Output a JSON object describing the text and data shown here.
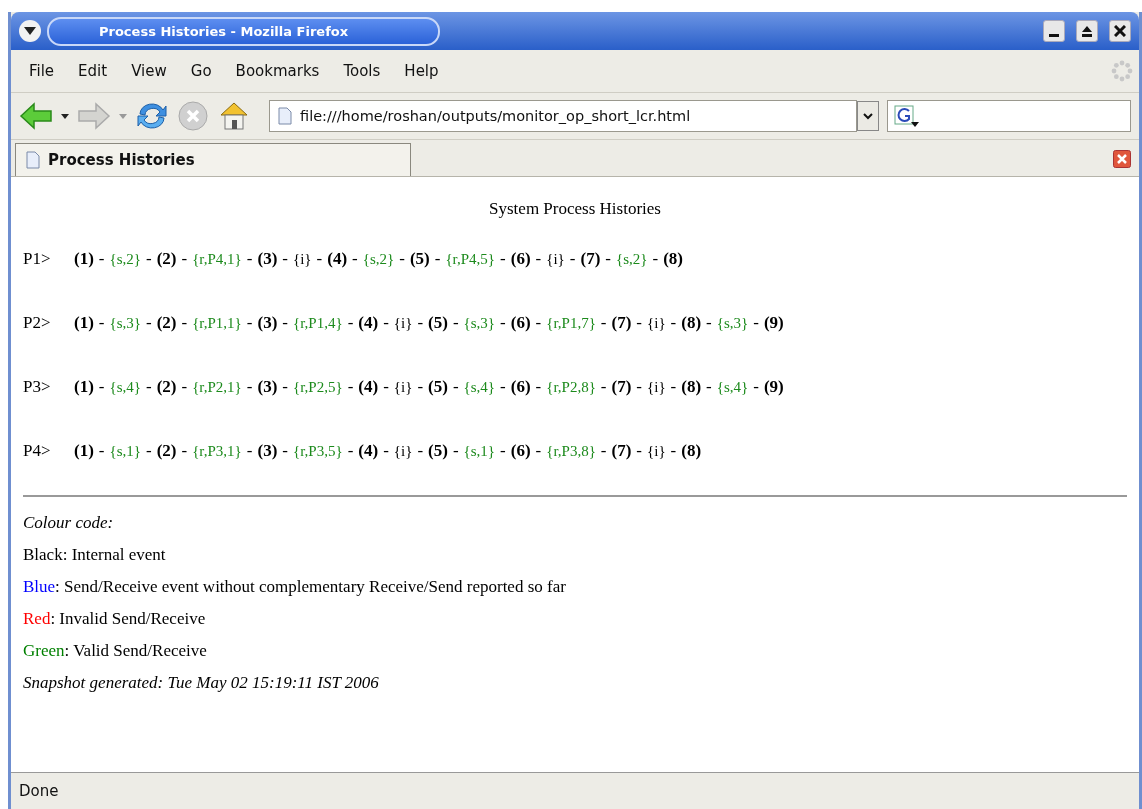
{
  "window": {
    "title": "Process Histories - Mozilla Firefox"
  },
  "menu": [
    "File",
    "Edit",
    "View",
    "Go",
    "Bookmarks",
    "Tools",
    "Help"
  ],
  "toolbar": {
    "back_disabled": false,
    "forward_disabled": true,
    "stop_disabled": true,
    "url": "file:///home/roshan/outputs/monitor_op_short_lcr.html"
  },
  "tabs": [
    {
      "label": "Process Histories",
      "selected": true
    }
  ],
  "page": {
    "heading": "System Process Histories",
    "processes": [
      {
        "label": "P1>",
        "items": [
          {
            "text": "(1)",
            "kind": "state"
          },
          {
            "text": "-",
            "kind": "dash"
          },
          {
            "text": "{s,2}",
            "kind": "valid"
          },
          {
            "text": "-",
            "kind": "dash"
          },
          {
            "text": "(2)",
            "kind": "state"
          },
          {
            "text": "-",
            "kind": "dash"
          },
          {
            "text": "{r,P4,1}",
            "kind": "valid"
          },
          {
            "text": "-",
            "kind": "dash"
          },
          {
            "text": "(3)",
            "kind": "state"
          },
          {
            "text": "-",
            "kind": "dash"
          },
          {
            "text": "{i}",
            "kind": "internal"
          },
          {
            "text": "-",
            "kind": "dash"
          },
          {
            "text": "(4)",
            "kind": "state"
          },
          {
            "text": "-",
            "kind": "dash"
          },
          {
            "text": "{s,2}",
            "kind": "valid"
          },
          {
            "text": "-",
            "kind": "dash"
          },
          {
            "text": "(5)",
            "kind": "state"
          },
          {
            "text": "-",
            "kind": "dash"
          },
          {
            "text": "{r,P4,5}",
            "kind": "valid"
          },
          {
            "text": "-",
            "kind": "dash"
          },
          {
            "text": "(6)",
            "kind": "state"
          },
          {
            "text": "-",
            "kind": "dash"
          },
          {
            "text": "{i}",
            "kind": "internal"
          },
          {
            "text": "-",
            "kind": "dash"
          },
          {
            "text": "(7)",
            "kind": "state"
          },
          {
            "text": "-",
            "kind": "dash"
          },
          {
            "text": "{s,2}",
            "kind": "valid"
          },
          {
            "text": "-",
            "kind": "dash"
          },
          {
            "text": "(8)",
            "kind": "state"
          }
        ]
      },
      {
        "label": "P2>",
        "items": [
          {
            "text": "(1)",
            "kind": "state"
          },
          {
            "text": "-",
            "kind": "dash"
          },
          {
            "text": "{s,3}",
            "kind": "valid"
          },
          {
            "text": "-",
            "kind": "dash"
          },
          {
            "text": "(2)",
            "kind": "state"
          },
          {
            "text": "-",
            "kind": "dash"
          },
          {
            "text": "{r,P1,1}",
            "kind": "valid"
          },
          {
            "text": "-",
            "kind": "dash"
          },
          {
            "text": "(3)",
            "kind": "state"
          },
          {
            "text": "-",
            "kind": "dash"
          },
          {
            "text": "{r,P1,4}",
            "kind": "valid"
          },
          {
            "text": "-",
            "kind": "dash"
          },
          {
            "text": "(4)",
            "kind": "state"
          },
          {
            "text": "-",
            "kind": "dash"
          },
          {
            "text": "{i}",
            "kind": "internal"
          },
          {
            "text": "-",
            "kind": "dash"
          },
          {
            "text": "(5)",
            "kind": "state"
          },
          {
            "text": "-",
            "kind": "dash"
          },
          {
            "text": "{s,3}",
            "kind": "valid"
          },
          {
            "text": "-",
            "kind": "dash"
          },
          {
            "text": "(6)",
            "kind": "state"
          },
          {
            "text": "-",
            "kind": "dash"
          },
          {
            "text": "{r,P1,7}",
            "kind": "valid"
          },
          {
            "text": "-",
            "kind": "dash"
          },
          {
            "text": "(7)",
            "kind": "state"
          },
          {
            "text": "-",
            "kind": "dash"
          },
          {
            "text": "{i}",
            "kind": "internal"
          },
          {
            "text": "-",
            "kind": "dash"
          },
          {
            "text": "(8)",
            "kind": "state"
          },
          {
            "text": "-",
            "kind": "dash"
          },
          {
            "text": "{s,3}",
            "kind": "valid"
          },
          {
            "text": "-",
            "kind": "dash"
          },
          {
            "text": "(9)",
            "kind": "state"
          }
        ]
      },
      {
        "label": "P3>",
        "items": [
          {
            "text": "(1)",
            "kind": "state"
          },
          {
            "text": "-",
            "kind": "dash"
          },
          {
            "text": "{s,4}",
            "kind": "valid"
          },
          {
            "text": "-",
            "kind": "dash"
          },
          {
            "text": "(2)",
            "kind": "state"
          },
          {
            "text": "-",
            "kind": "dash"
          },
          {
            "text": "{r,P2,1}",
            "kind": "valid"
          },
          {
            "text": "-",
            "kind": "dash"
          },
          {
            "text": "(3)",
            "kind": "state"
          },
          {
            "text": "-",
            "kind": "dash"
          },
          {
            "text": "{r,P2,5}",
            "kind": "valid"
          },
          {
            "text": "-",
            "kind": "dash"
          },
          {
            "text": "(4)",
            "kind": "state"
          },
          {
            "text": "-",
            "kind": "dash"
          },
          {
            "text": "{i}",
            "kind": "internal"
          },
          {
            "text": "-",
            "kind": "dash"
          },
          {
            "text": "(5)",
            "kind": "state"
          },
          {
            "text": "-",
            "kind": "dash"
          },
          {
            "text": "{s,4}",
            "kind": "valid"
          },
          {
            "text": "-",
            "kind": "dash"
          },
          {
            "text": "(6)",
            "kind": "state"
          },
          {
            "text": "-",
            "kind": "dash"
          },
          {
            "text": "{r,P2,8}",
            "kind": "valid"
          },
          {
            "text": "-",
            "kind": "dash"
          },
          {
            "text": "(7)",
            "kind": "state"
          },
          {
            "text": "-",
            "kind": "dash"
          },
          {
            "text": "{i}",
            "kind": "internal"
          },
          {
            "text": "-",
            "kind": "dash"
          },
          {
            "text": "(8)",
            "kind": "state"
          },
          {
            "text": "-",
            "kind": "dash"
          },
          {
            "text": "{s,4}",
            "kind": "valid"
          },
          {
            "text": "-",
            "kind": "dash"
          },
          {
            "text": "(9)",
            "kind": "state"
          }
        ]
      },
      {
        "label": "P4>",
        "items": [
          {
            "text": "(1)",
            "kind": "state"
          },
          {
            "text": "-",
            "kind": "dash"
          },
          {
            "text": "{s,1}",
            "kind": "valid"
          },
          {
            "text": "-",
            "kind": "dash"
          },
          {
            "text": "(2)",
            "kind": "state"
          },
          {
            "text": "-",
            "kind": "dash"
          },
          {
            "text": "{r,P3,1}",
            "kind": "valid"
          },
          {
            "text": "-",
            "kind": "dash"
          },
          {
            "text": "(3)",
            "kind": "state"
          },
          {
            "text": "-",
            "kind": "dash"
          },
          {
            "text": "{r,P3,5}",
            "kind": "valid"
          },
          {
            "text": "-",
            "kind": "dash"
          },
          {
            "text": "(4)",
            "kind": "state"
          },
          {
            "text": "-",
            "kind": "dash"
          },
          {
            "text": "{i}",
            "kind": "internal"
          },
          {
            "text": "-",
            "kind": "dash"
          },
          {
            "text": "(5)",
            "kind": "state"
          },
          {
            "text": "-",
            "kind": "dash"
          },
          {
            "text": "{s,1}",
            "kind": "valid"
          },
          {
            "text": "-",
            "kind": "dash"
          },
          {
            "text": "(6)",
            "kind": "state"
          },
          {
            "text": "-",
            "kind": "dash"
          },
          {
            "text": "{r,P3,8}",
            "kind": "valid"
          },
          {
            "text": "-",
            "kind": "dash"
          },
          {
            "text": "(7)",
            "kind": "state"
          },
          {
            "text": "-",
            "kind": "dash"
          },
          {
            "text": "{i}",
            "kind": "internal"
          },
          {
            "text": "-",
            "kind": "dash"
          },
          {
            "text": "(8)",
            "kind": "state"
          }
        ]
      }
    ],
    "legend_title": "Colour code:",
    "legend": [
      {
        "label": "Black",
        "color": "#000000",
        "text": ": Internal event"
      },
      {
        "label": "Blue",
        "color": "#0000ff",
        "text": ": Send/Receive event without complementary Receive/Send reported so far"
      },
      {
        "label": "Red",
        "color": "#ff0000",
        "text": ": Invalid Send/Receive"
      },
      {
        "label": "Green",
        "color": "#008000",
        "text": ": Valid Send/Receive"
      }
    ],
    "snapshot": "Snapshot generated: Tue May 02 15:19:11 IST 2006"
  },
  "status_bar": "Done"
}
